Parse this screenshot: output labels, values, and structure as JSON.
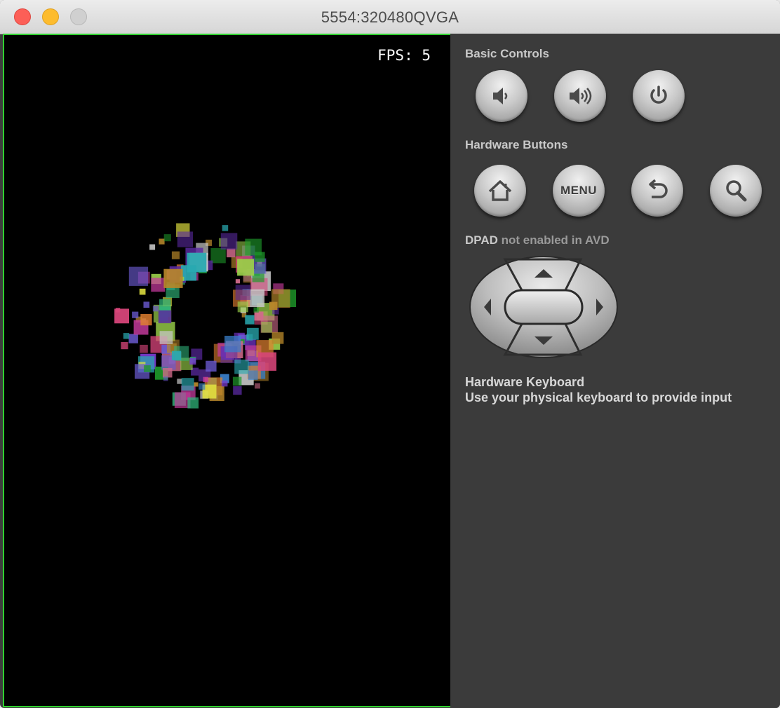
{
  "window": {
    "title": "5554:320480QVGA"
  },
  "screen": {
    "fps_label": "FPS: 5"
  },
  "panel": {
    "basic_controls": {
      "heading": "Basic Controls"
    },
    "hardware_buttons": {
      "heading": "Hardware Buttons",
      "menu_label": "MENU"
    },
    "dpad": {
      "heading_strong": "DPAD",
      "heading_rest": " not enabled in AVD"
    },
    "keyboard": {
      "title": "Hardware Keyboard",
      "subtitle": "Use your physical keyboard to provide input"
    }
  },
  "colors": {
    "screen_border": "#2fd12f",
    "panel_bg": "#3b3b3b",
    "screen_bg": "#000000"
  }
}
